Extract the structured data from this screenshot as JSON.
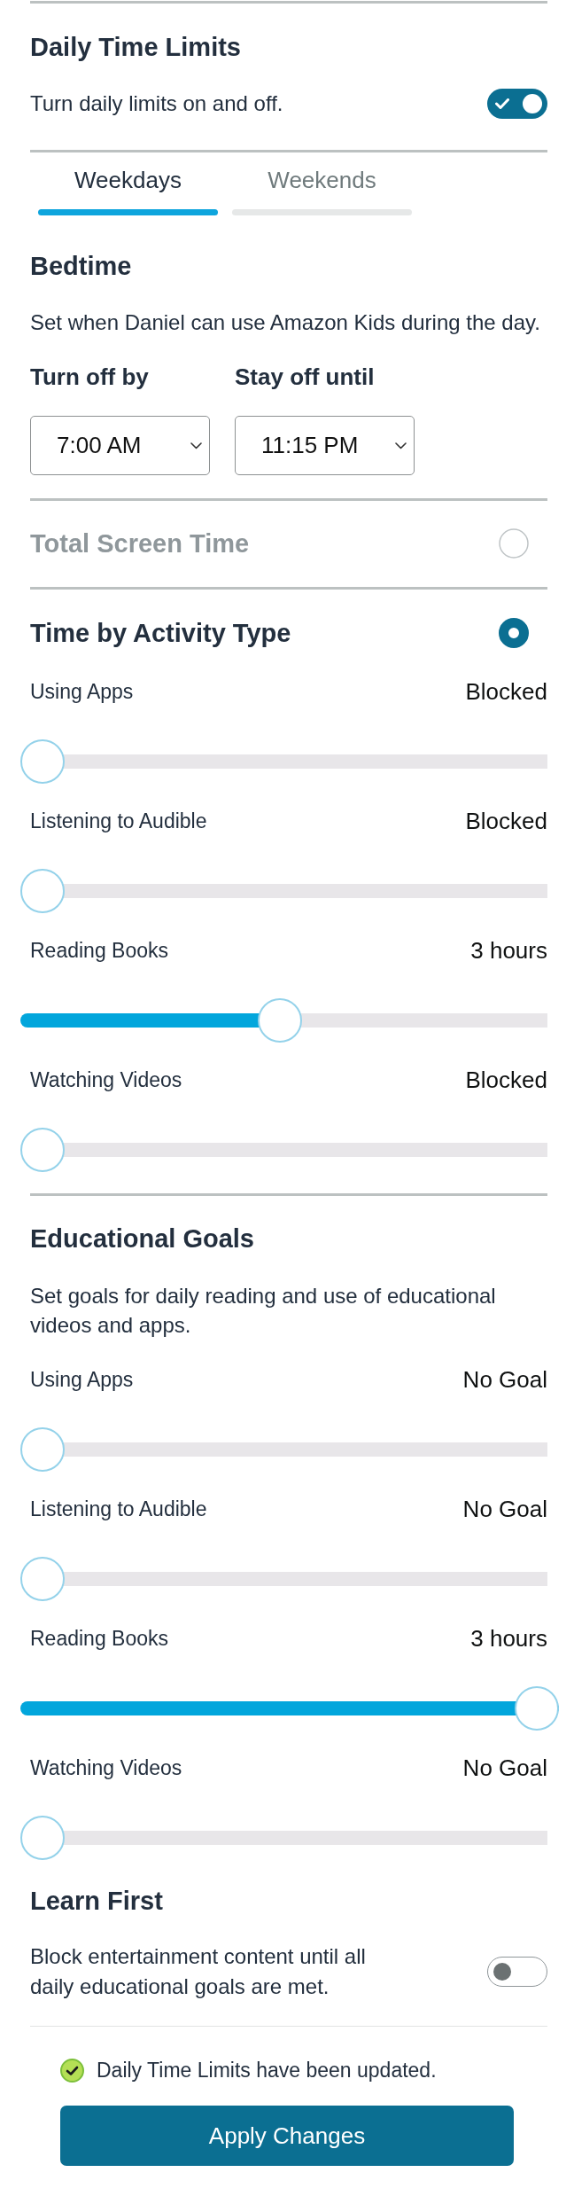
{
  "daily_limits": {
    "title": "Daily Time Limits",
    "switch_label": "Turn daily limits on and off.",
    "on": true
  },
  "tabs": [
    {
      "label": "Weekdays",
      "selected": true
    },
    {
      "label": "Weekends",
      "selected": false
    }
  ],
  "bedtime": {
    "title": "Bedtime",
    "description": "Set when Daniel can use Amazon Kids during the day.",
    "fields": [
      {
        "label": "Turn off by",
        "value": "7:00 AM"
      },
      {
        "label": "Stay off until",
        "value": "11:15 PM"
      }
    ]
  },
  "limit_modes": [
    {
      "label": "Total Screen Time",
      "selected": false
    },
    {
      "label": "Time by Activity Type",
      "selected": true
    }
  ],
  "activity_limits": [
    {
      "label": "Using Apps",
      "reading": "Blocked",
      "level": 0
    },
    {
      "label": "Listening to Audible",
      "reading": "Blocked",
      "level": 0
    },
    {
      "label": "Reading Books",
      "reading": "3 hours",
      "level": 0.48
    },
    {
      "label": "Watching Videos",
      "reading": "Blocked",
      "level": 0
    }
  ],
  "educational_goals": {
    "title": "Educational Goals",
    "description": "Set goals for daily reading and use of educational videos and apps.",
    "goals": [
      {
        "label": "Using Apps",
        "reading": "No Goal",
        "level": 0
      },
      {
        "label": "Listening to Audible",
        "reading": "No Goal",
        "level": 0
      },
      {
        "label": "Reading Books",
        "reading": "3 hours",
        "level": 1
      },
      {
        "label": "Watching Videos",
        "reading": "No Goal",
        "level": 0
      }
    ]
  },
  "learn_first": {
    "title": "Learn First",
    "description": "Block entertainment content until all daily educational goals are met.",
    "on": false
  },
  "status_message": "Daily Time Limits have been updated.",
  "apply_button": "Apply Changes"
}
